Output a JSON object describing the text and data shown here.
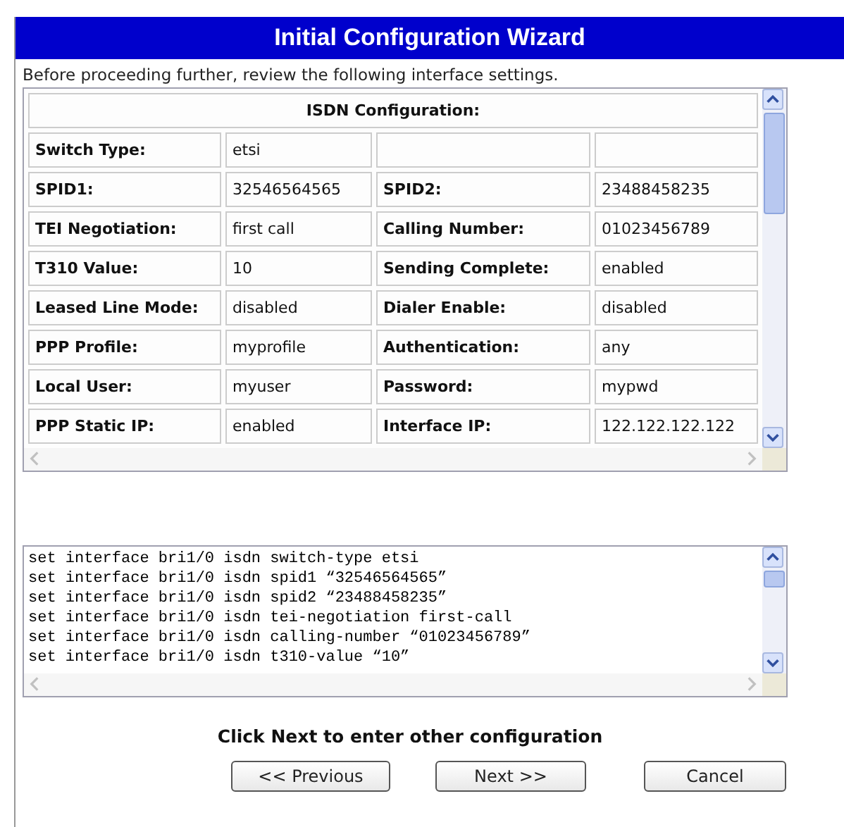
{
  "window": {
    "title": "Initial Configuration Wizard"
  },
  "intro": "Before proceeding further, review the following interface settings.",
  "settings_table": {
    "heading": "ISDN Configuration:",
    "rows": [
      {
        "label_1": "Switch Type:",
        "value_1": "etsi"
      },
      {
        "label_1": "SPID1:",
        "value_1": "32546564565",
        "label_2": "SPID2:",
        "value_2": "23488458235"
      },
      {
        "label_1": "TEI Negotiation:",
        "value_1": "first call",
        "label_2": "Calling Number:",
        "value_2": "01023456789"
      },
      {
        "label_1": "T310 Value:",
        "value_1": "10",
        "label_2": "Sending Complete:",
        "value_2": "enabled"
      },
      {
        "label_1": "Leased Line Mode:",
        "value_1": "disabled",
        "label_2": "Dialer Enable:",
        "value_2": "disabled"
      },
      {
        "label_1": "PPP Profile:",
        "value_1": "myprofile",
        "label_2": "Authentication:",
        "value_2": "any"
      },
      {
        "label_1": "Local User:",
        "value_1": "myuser",
        "label_2": "Password:",
        "value_2": "mypwd"
      },
      {
        "label_1": "PPP Static IP:",
        "value_1": "enabled",
        "label_2": "Interface IP:",
        "value_2": "122.122.122.122"
      }
    ]
  },
  "command_lines": [
    "set interface bri1/0 isdn switch-type etsi",
    "set interface bri1/0 isdn spid1 “32546564565”",
    "set interface bri1/0 isdn spid2 “23488458235”",
    "set interface bri1/0 isdn tei-negotiation first-call",
    "set interface bri1/0 isdn calling-number “01023456789”",
    "set interface bri1/0 isdn t310-value “10”"
  ],
  "caption": "Click Next to enter other configuration",
  "buttons": [
    {
      "label": "<< Previous"
    },
    {
      "label": "Next >>"
    },
    {
      "label": "Cancel"
    }
  ]
}
